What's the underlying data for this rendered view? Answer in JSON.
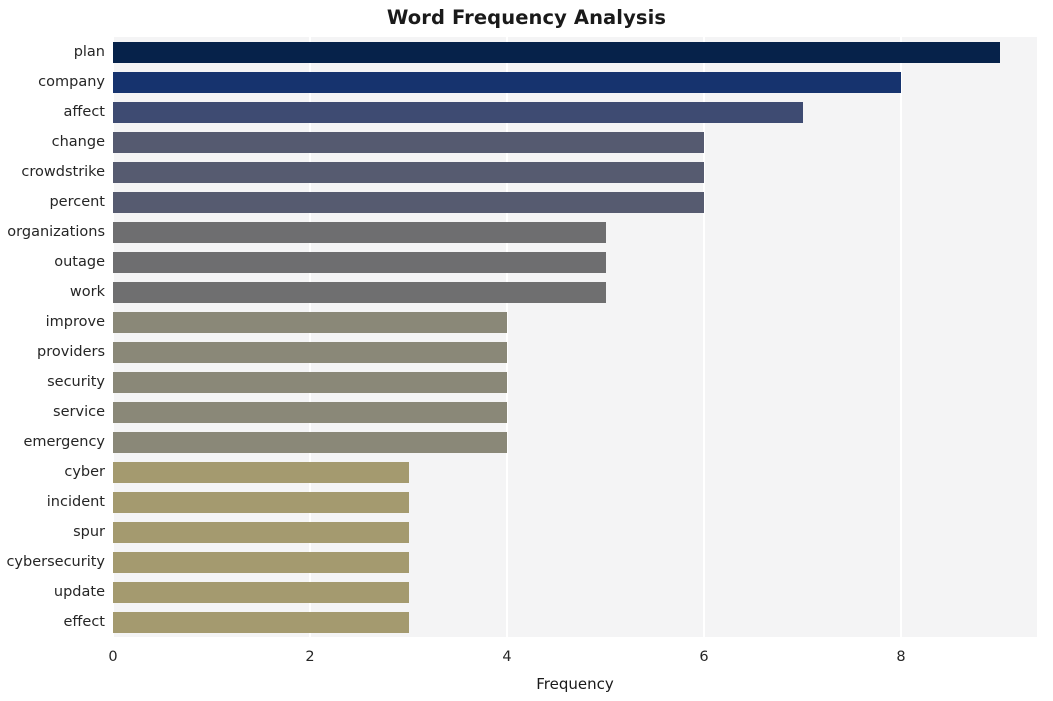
{
  "chart_data": {
    "type": "bar",
    "orientation": "horizontal",
    "title": "Word Frequency Analysis",
    "xlabel": "Frequency",
    "ylabel": "",
    "categories": [
      "plan",
      "company",
      "affect",
      "change",
      "crowdstrike",
      "percent",
      "organizations",
      "outage",
      "work",
      "improve",
      "providers",
      "security",
      "service",
      "emergency",
      "cyber",
      "incident",
      "spur",
      "cybersecurity",
      "update",
      "effect"
    ],
    "values": [
      9,
      8,
      7,
      6,
      6,
      6,
      5,
      5,
      5,
      4,
      4,
      4,
      4,
      4,
      3,
      3,
      3,
      3,
      3,
      3
    ],
    "xlim": [
      0,
      9.38
    ],
    "xticks": [
      0,
      2,
      4,
      6,
      8
    ],
    "xticklabels": [
      "0",
      "2",
      "4",
      "6",
      "8"
    ],
    "grid": "vertical-only",
    "legend": "none",
    "bar_colors": [
      "#06224a",
      "#16336e",
      "#3e4b72",
      "#555a70",
      "#565b70",
      "#565b70",
      "#6e6e70",
      "#6e6e70",
      "#6f6f70",
      "#8a8878",
      "#8a8878",
      "#8a8878",
      "#8a8878",
      "#8a8878",
      "#a49a6f",
      "#a49a6f",
      "#a49a6f",
      "#a49a6f",
      "#a49a6f",
      "#a49a6f"
    ],
    "style": {
      "plot_background": "#f4f4f5",
      "figure_background": "#ffffff",
      "gridline_color": "#ffffff",
      "tick_label_color": "#262626"
    }
  }
}
